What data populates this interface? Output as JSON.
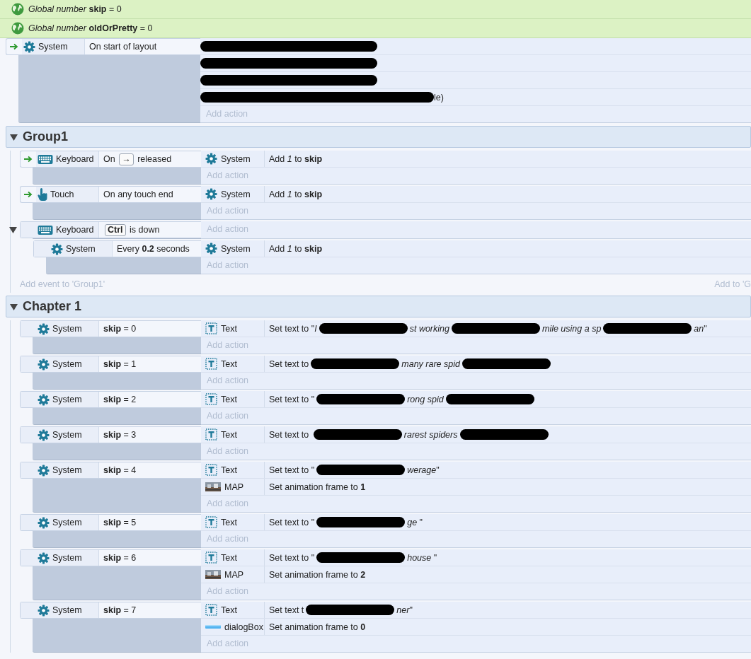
{
  "globals": [
    {
      "text": "*Global number* **skip** = 0"
    },
    {
      "text": "*Global number* **oldOrPretty** = 0"
    }
  ],
  "events": [
    {
      "trigger": true,
      "conditions": [
        {
          "object": "System",
          "kind": "gear",
          "segments": [
            {
              "kind": "text",
              "text": "On start of layout"
            }
          ]
        }
      ],
      "actions": [
        {
          "segments": [
            {
              "kind": "redaction"
            }
          ]
        },
        {
          "segments": [
            {
              "kind": "redaction"
            }
          ]
        },
        {
          "segments": [
            {
              "kind": "redaction"
            }
          ]
        },
        {
          "segments": [
            {
              "kind": "redaction"
            },
            {
              "kind": "text",
              "text": "le)"
            }
          ]
        }
      ],
      "add_action": "Add action"
    }
  ],
  "groups": [
    {
      "title": "Group1",
      "expanded": true,
      "add_event": "Add event to 'Group1'",
      "add_event_right": "Add to 'G",
      "events": [
        {
          "trigger": true,
          "conditions": [
            {
              "object": "Keyboard",
              "kind": "keyboard",
              "segments": [
                {
                  "kind": "text",
                  "text": "On "
                },
                {
                  "kind": "key",
                  "text": "→"
                },
                {
                  "kind": "text",
                  "text": " released"
                }
              ]
            }
          ],
          "actions": [
            {
              "object": "System",
              "kind": "gear",
              "segments": [
                {
                  "kind": "text",
                  "text": "Add *1* to **skip**"
                }
              ]
            }
          ],
          "add_action": "Add action"
        },
        {
          "trigger": true,
          "conditions": [
            {
              "object": "Touch",
              "kind": "touch",
              "segments": [
                {
                  "kind": "text",
                  "text": "On any touch end"
                }
              ]
            }
          ],
          "actions": [
            {
              "object": "System",
              "kind": "gear",
              "segments": [
                {
                  "kind": "text",
                  "text": "Add *1* to **skip**"
                }
              ]
            }
          ],
          "add_action": "Add action"
        },
        {
          "trigger": false,
          "expanded": true,
          "conditions": [
            {
              "object": "Keyboard",
              "kind": "keyboard",
              "segments": [
                {
                  "kind": "key",
                  "text": "Ctrl"
                },
                {
                  "kind": "text",
                  "text": " is down"
                }
              ]
            }
          ],
          "add_action": "Add action",
          "children": [
            {
              "trigger": false,
              "conditions": [
                {
                  "object": "System",
                  "kind": "gear",
                  "segments": [
                    {
                      "kind": "text",
                      "text": "Every **0.2** seconds"
                    }
                  ]
                }
              ],
              "actions": [
                {
                  "object": "System",
                  "kind": "gear",
                  "segments": [
                    {
                      "kind": "text",
                      "text": "Add *1* to **skip**"
                    }
                  ]
                }
              ],
              "add_action": "Add action"
            }
          ]
        }
      ]
    },
    {
      "title": "Chapter 1",
      "expanded": true,
      "events": [
        {
          "trigger": false,
          "conditions": [
            {
              "object": "System",
              "kind": "gear",
              "segments": [
                {
                  "kind": "text",
                  "text": "**skip** = 0"
                }
              ]
            }
          ],
          "actions": [
            {
              "object": "Text",
              "kind": "text",
              "segments": [
                {
                  "kind": "text",
                  "text": "Set text to \"*I*"
                },
                {
                  "kind": "redaction"
                },
                {
                  "kind": "text",
                  "text": "*st working*"
                },
                {
                  "kind": "redaction"
                },
                {
                  "kind": "text",
                  "text": "*mile using a sp*"
                },
                {
                  "kind": "redaction"
                },
                {
                  "kind": "text",
                  "text": "*an*\""
                }
              ]
            }
          ],
          "add_action": "Add action"
        },
        {
          "trigger": false,
          "conditions": [
            {
              "object": "System",
              "kind": "gear",
              "segments": [
                {
                  "kind": "text",
                  "text": "**skip** = 1"
                }
              ]
            }
          ],
          "actions": [
            {
              "object": "Text",
              "kind": "text",
              "segments": [
                {
                  "kind": "text",
                  "text": "Set text to"
                },
                {
                  "kind": "redaction"
                },
                {
                  "kind": "text",
                  "text": "*many rare spid*"
                },
                {
                  "kind": "redaction"
                }
              ]
            }
          ],
          "add_action": "Add action"
        },
        {
          "trigger": false,
          "conditions": [
            {
              "object": "System",
              "kind": "gear",
              "segments": [
                {
                  "kind": "text",
                  "text": "**skip** = 2"
                }
              ]
            }
          ],
          "actions": [
            {
              "object": "Text",
              "kind": "text",
              "segments": [
                {
                  "kind": "text",
                  "text": "Set text to \""
                },
                {
                  "kind": "redaction"
                },
                {
                  "kind": "text",
                  "text": "*rong spid*"
                },
                {
                  "kind": "redaction"
                }
              ]
            }
          ],
          "add_action": "Add action"
        },
        {
          "trigger": false,
          "conditions": [
            {
              "object": "System",
              "kind": "gear",
              "segments": [
                {
                  "kind": "text",
                  "text": "**skip** = 3"
                }
              ]
            }
          ],
          "actions": [
            {
              "object": "Text",
              "kind": "text",
              "segments": [
                {
                  "kind": "text",
                  "text": "Set text to "
                },
                {
                  "kind": "redaction"
                },
                {
                  "kind": "text",
                  "text": "*rarest spiders*"
                },
                {
                  "kind": "redaction"
                }
              ]
            }
          ],
          "add_action": "Add action"
        },
        {
          "trigger": false,
          "conditions": [
            {
              "object": "System",
              "kind": "gear",
              "segments": [
                {
                  "kind": "text",
                  "text": "**skip** = 4"
                }
              ]
            }
          ],
          "actions": [
            {
              "object": "Text",
              "kind": "text",
              "segments": [
                {
                  "kind": "text",
                  "text": "Set text to \""
                },
                {
                  "kind": "redaction"
                },
                {
                  "kind": "text",
                  "text": "*werage*\""
                }
              ]
            },
            {
              "object": "MAP",
              "kind": "map",
              "segments": [
                {
                  "kind": "text",
                  "text": "Set animation frame to **1**"
                }
              ]
            }
          ],
          "add_action": "Add action"
        },
        {
          "trigger": false,
          "conditions": [
            {
              "object": "System",
              "kind": "gear",
              "segments": [
                {
                  "kind": "text",
                  "text": "**skip** = 5"
                }
              ]
            }
          ],
          "actions": [
            {
              "object": "Text",
              "kind": "text",
              "segments": [
                {
                  "kind": "text",
                  "text": "Set text to \""
                },
                {
                  "kind": "redaction"
                },
                {
                  "kind": "text",
                  "text": "*ge* \""
                }
              ]
            }
          ],
          "add_action": "Add action"
        },
        {
          "trigger": false,
          "conditions": [
            {
              "object": "System",
              "kind": "gear",
              "segments": [
                {
                  "kind": "text",
                  "text": "**skip** = 6"
                }
              ]
            }
          ],
          "actions": [
            {
              "object": "Text",
              "kind": "text",
              "segments": [
                {
                  "kind": "text",
                  "text": "Set text to \""
                },
                {
                  "kind": "redaction"
                },
                {
                  "kind": "text",
                  "text": "*house* \""
                }
              ]
            },
            {
              "object": "MAP",
              "kind": "map",
              "segments": [
                {
                  "kind": "text",
                  "text": "Set animation frame to **2**"
                }
              ]
            }
          ],
          "add_action": "Add action"
        },
        {
          "trigger": false,
          "conditions": [
            {
              "object": "System",
              "kind": "gear",
              "segments": [
                {
                  "kind": "text",
                  "text": "**skip** = 7"
                }
              ]
            }
          ],
          "actions": [
            {
              "object": "Text",
              "kind": "text",
              "segments": [
                {
                  "kind": "text",
                  "text": "Set text t"
                },
                {
                  "kind": "redaction"
                },
                {
                  "kind": "text",
                  "text": "*ner*\""
                }
              ]
            },
            {
              "object": "dialogBox",
              "kind": "bar",
              "segments": [
                {
                  "kind": "text",
                  "text": "Set animation frame to **0**"
                }
              ]
            }
          ],
          "add_action": "Add action"
        }
      ]
    }
  ]
}
